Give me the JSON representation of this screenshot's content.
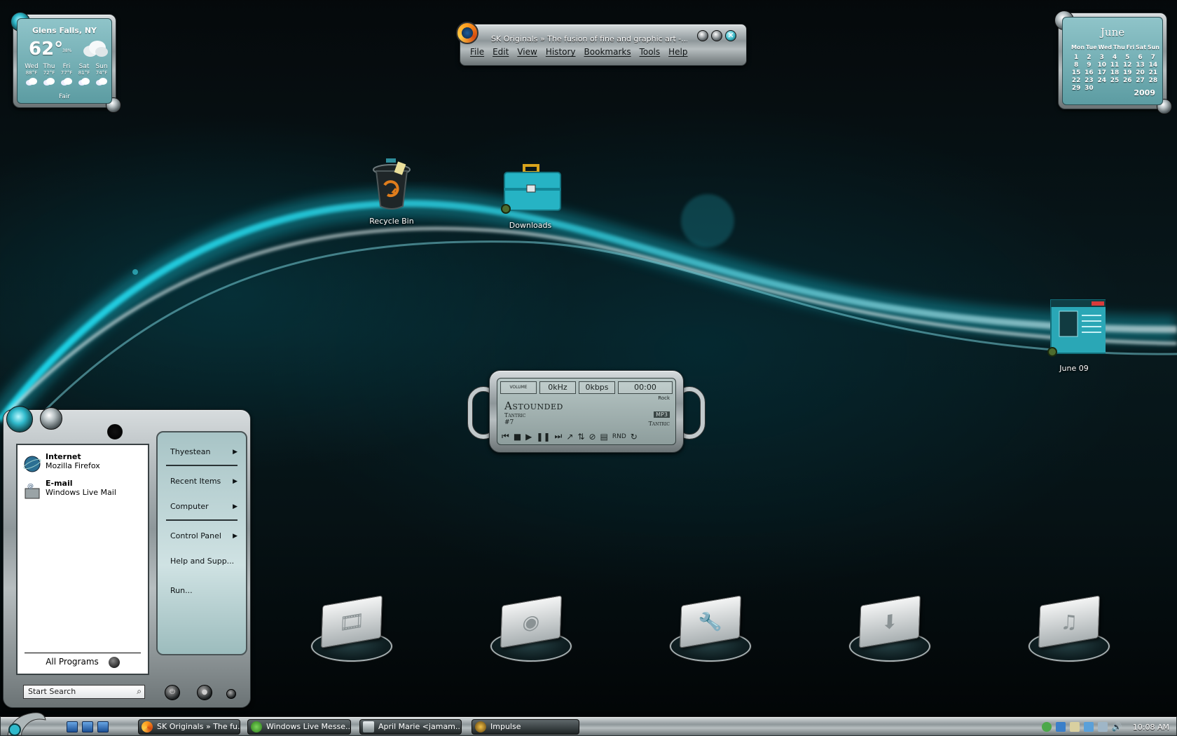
{
  "weather": {
    "city": "Glens Falls, NY",
    "temp": "62°",
    "humidity": "38%",
    "condition": "Fair",
    "forecast": [
      {
        "day": "Wed",
        "hi": "88°F"
      },
      {
        "day": "Thu",
        "hi": "72°F"
      },
      {
        "day": "Fri",
        "hi": "77°F"
      },
      {
        "day": "Sat",
        "hi": "81°F"
      },
      {
        "day": "Sun",
        "hi": "74°F"
      }
    ]
  },
  "firefox": {
    "title": "SK Originals » The fusion of fine and graphic art -...",
    "menu": [
      "File",
      "Edit",
      "View",
      "History",
      "Bookmarks",
      "Tools",
      "Help"
    ]
  },
  "calendar": {
    "month": "June",
    "year": "2009",
    "weekdays": [
      "Mon",
      "Tue",
      "Wed",
      "Thu",
      "Fri",
      "Sat",
      "Sun"
    ],
    "days": [
      "1",
      "2",
      "3",
      "4",
      "5",
      "6",
      "7",
      "8",
      "9",
      "10",
      "11",
      "12",
      "13",
      "14",
      "15",
      "16",
      "17",
      "18",
      "19",
      "20",
      "21",
      "22",
      "23",
      "24",
      "25",
      "26",
      "27",
      "28",
      "29",
      "30"
    ]
  },
  "desktop_icons": {
    "recycle_bin": "Recycle Bin",
    "downloads": "Downloads",
    "june09": "June 09"
  },
  "player": {
    "volume_label": "VOLUME",
    "khz": "0kHz",
    "kbps": "0kbps",
    "time": "00:00",
    "genre": "Rock",
    "track": "Astounded",
    "artist": "Tantric",
    "track_number": "#7",
    "format": "MP3",
    "artist_right": "Tantric",
    "rnd": "RND"
  },
  "start_menu": {
    "programs": [
      {
        "title": "Internet",
        "subtitle": "Mozilla Firefox"
      },
      {
        "title": "E-mail",
        "subtitle": "Windows Live Mail"
      }
    ],
    "all_programs": "All Programs",
    "right_items": [
      {
        "label": "Thyestean",
        "arrow": true
      },
      {
        "label": "Recent Items",
        "arrow": true
      },
      {
        "label": "Computer",
        "arrow": true
      },
      {
        "label": "Control Panel",
        "arrow": true
      },
      {
        "label": "Help and Supp...",
        "arrow": false
      },
      {
        "label": "Run...",
        "arrow": false
      }
    ],
    "search_placeholder": "Start Search"
  },
  "taskbar": {
    "tasks": [
      {
        "label": "SK Originals » The fu..."
      },
      {
        "label": "Windows Live Messe..."
      },
      {
        "label": "April Marie <jamam..."
      },
      {
        "label": "Impulse"
      }
    ],
    "clock": "10:08 AM"
  },
  "colors": {
    "accent": "#2fb9cb",
    "wallpaper": "#061215",
    "lcd": "#8fc4c9"
  }
}
